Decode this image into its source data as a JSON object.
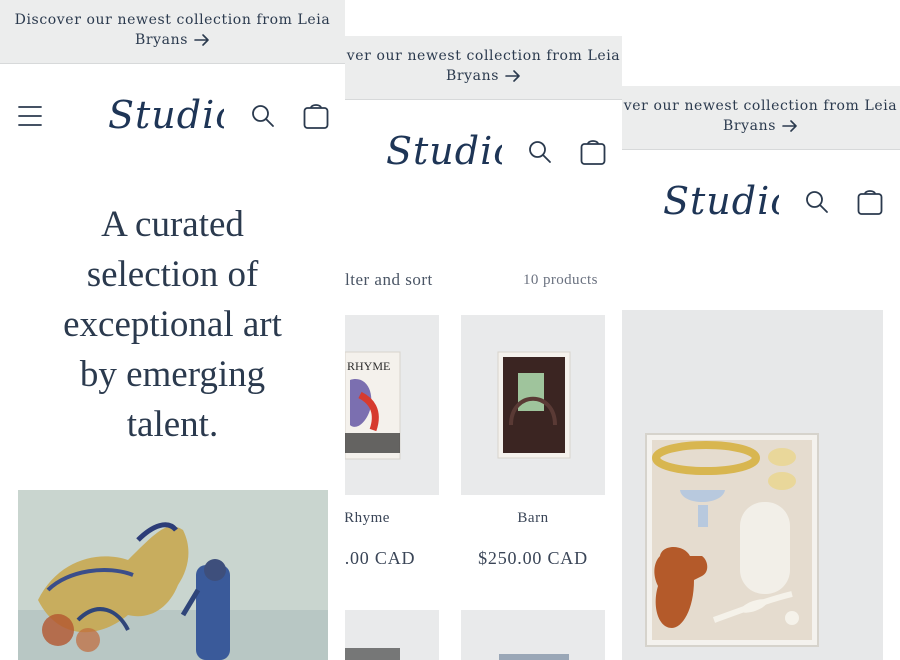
{
  "announcement": {
    "line1": "Discover our newest collection from Leia",
    "line2": "Bryans",
    "line1_partial": "ver our newest collection from Leia"
  },
  "logo": "Studio",
  "hero": {
    "lines": [
      "A curated",
      "selection of",
      "exceptional art",
      "by emerging",
      "talent."
    ]
  },
  "collection": {
    "filter_label": "lter and sort",
    "product_count": "10 products",
    "products": [
      {
        "title": "Rhyme",
        "price": ".00 CAD",
        "tag": "RHYME"
      },
      {
        "title": "Barn",
        "price": "$250.00 CAD"
      }
    ]
  },
  "colors": {
    "text": "#2b3a4e",
    "logo": "#1e3556",
    "announcement_bg": "#eceded"
  },
  "icons": [
    "menu-icon",
    "search-icon",
    "cart-icon",
    "arrow-right-icon"
  ]
}
